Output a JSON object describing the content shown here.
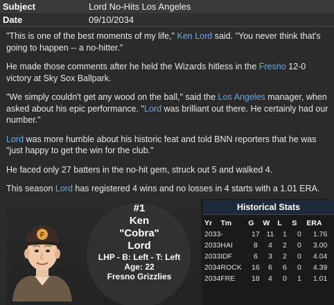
{
  "header": {
    "subject_label": "Subject",
    "subject_value": "Lord No-Hits Los Angeles",
    "date_label": "Date",
    "date_value": "09/10/2034"
  },
  "article": {
    "p1": [
      {
        "t": "\"This is one of the best moments of my life,\" "
      },
      {
        "t": "Ken Lord",
        "link": true
      },
      {
        "t": " said. \"You never think that's going to happen -- a no-hitter.\""
      }
    ],
    "p2": [
      {
        "t": "He made those comments after he held the Wizards hitless in the "
      },
      {
        "t": "Fresno",
        "link": true
      },
      {
        "t": " 12-0 victory at Sky Sox Ballpark."
      }
    ],
    "p3": [
      {
        "t": "\"We simply couldn't get any wood on the ball,\" said the "
      },
      {
        "t": "Los Angeles",
        "link": true
      },
      {
        "t": " manager, when asked about his epic performance. \""
      },
      {
        "t": "Lord",
        "link": true
      },
      {
        "t": " was brilliant out there. He certainly had our number.\""
      }
    ],
    "p4": [
      {
        "t": "Lord",
        "link": true
      },
      {
        "t": " was more humble about his historic feat and told BNN reporters that he was \"just happy to get the win for the club.\""
      }
    ],
    "p5": [
      {
        "t": "He faced only 27 batters in the no-hit gem, struck out 5 and walked 4."
      }
    ],
    "p6": [
      {
        "t": "This season "
      },
      {
        "t": "Lord",
        "link": true
      },
      {
        "t": " has registered 4 wins and no losses in 4 starts with a 1.01 ERA."
      }
    ]
  },
  "player": {
    "number": "#1",
    "first": "Ken",
    "nickname": "\"Cobra\"",
    "last": "Lord",
    "bio": "LHP - B: Left - T: Left",
    "age": "Age: 22",
    "team": "Fresno Grizzlies"
  },
  "stats": {
    "title": "Historical Stats",
    "headers": [
      "Yr",
      "Tm",
      "G",
      "W",
      "L",
      "S",
      "ERA"
    ],
    "rows": [
      [
        "2033",
        "-",
        "17",
        "11",
        "1",
        "0",
        "1.76"
      ],
      [
        "2033",
        "HAI",
        "8",
        "4",
        "2",
        "0",
        "3.00"
      ],
      [
        "2033",
        "IDF",
        "6",
        "3",
        "2",
        "0",
        "4.04"
      ],
      [
        "2034",
        "ROCK",
        "16",
        "6",
        "6",
        "0",
        "4.39"
      ],
      [
        "2034",
        "FRE",
        "18",
        "4",
        "0",
        "1",
        "1.01"
      ]
    ]
  },
  "colors": {
    "link": "#6aa9e6",
    "background": "#2b2b2b"
  }
}
